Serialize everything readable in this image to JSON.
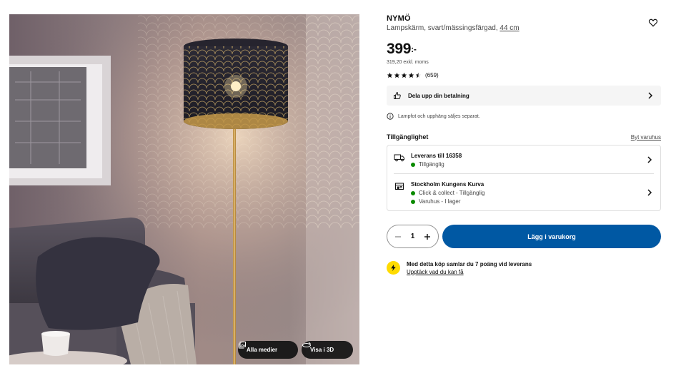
{
  "media": {
    "all_media_label": "Alla medier",
    "view_3d_label": "Visa i 3D"
  },
  "product": {
    "name": "NYMÖ",
    "description": "Lampskärm, svart/mässingsfärgad,",
    "size": "44 cm",
    "price_main": "399",
    "price_suffix": ":-",
    "price_excl": "319,20 exkl. moms",
    "rating_value": 4.5,
    "rating_count": "(659)"
  },
  "payment": {
    "split_label": "Dela upp din betalning"
  },
  "notice": {
    "text": "Lampfot och upphäng säljes separat."
  },
  "availability": {
    "title": "Tillgänglighet",
    "change_store": "Byt varuhus",
    "delivery": {
      "title": "Leverans till 16358",
      "status": "Tillgänglig"
    },
    "store": {
      "title": "Stockholm Kungens Kurva",
      "status_1": "Click & collect - Tillgänglig",
      "status_2": "Varuhus - I lager"
    }
  },
  "purchase": {
    "quantity": "1",
    "add_to_cart": "Lägg i varukorg"
  },
  "points": {
    "line1": "Med detta köp samlar du 7 poäng vid leverans",
    "line2": "Upptäck vad du kan få"
  },
  "colors": {
    "primary_blue": "#0058a3",
    "available_green": "#0a8a00",
    "family_yellow": "#ffdb00"
  }
}
